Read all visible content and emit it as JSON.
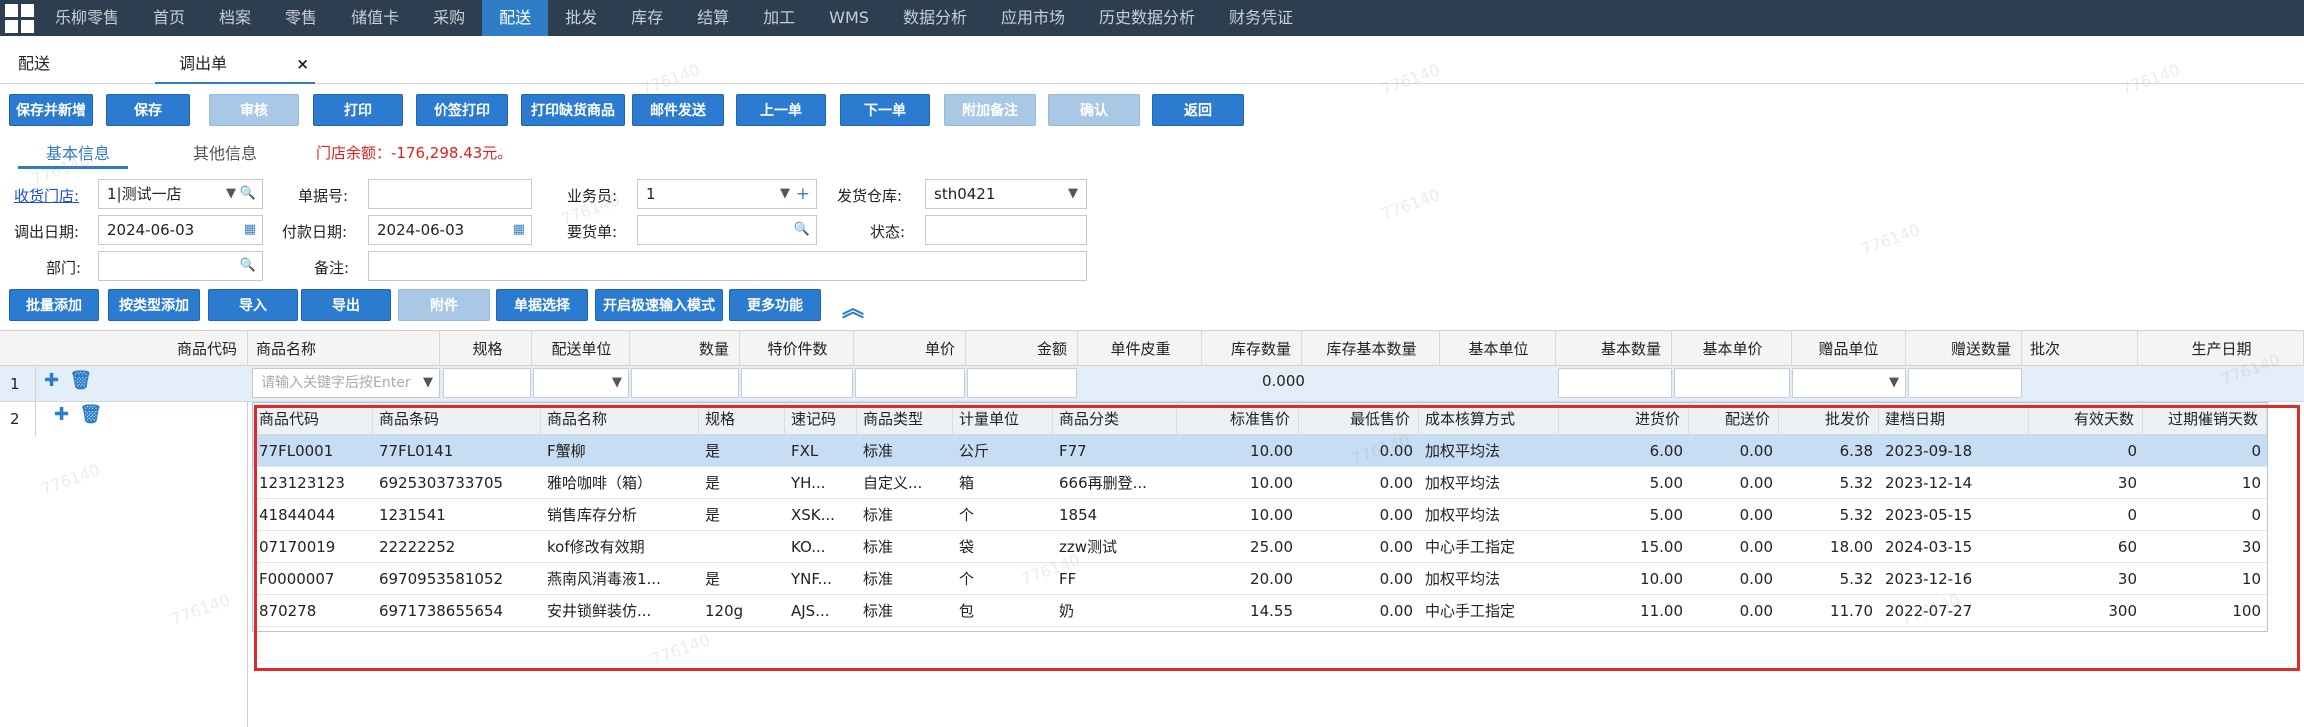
{
  "nav": {
    "items": [
      "乐柳零售",
      "首页",
      "档案",
      "零售",
      "储值卡",
      "采购",
      "配送",
      "批发",
      "库存",
      "结算",
      "加工",
      "WMS",
      "数据分析",
      "应用市场",
      "历史数据分析",
      "财务凭证"
    ],
    "active": "配送"
  },
  "tabs": {
    "t1": "配送",
    "t2": "调出单",
    "close": "×"
  },
  "toolbar": {
    "save_new": "保存并新增",
    "save": "保存",
    "audit": "审核",
    "print": "打印",
    "price_print": "价签打印",
    "print_missing": "打印缺货商品",
    "mail": "邮件发送",
    "prev": "上一单",
    "next": "下一单",
    "add_note": "附加备注",
    "confirm": "确认",
    "back": "返回"
  },
  "subtabs": {
    "basic": "基本信息",
    "other": "其他信息",
    "balance": "门店余额：-176,298.43元。"
  },
  "form": {
    "store_label": "收货门店:",
    "store_value": "1|测试一店",
    "docno_label": "单据号:",
    "docno_value": "",
    "staff_label": "业务员:",
    "staff_value": "1",
    "warehouse_label": "发货仓库:",
    "warehouse_value": "sth0421",
    "date_label": "调出日期:",
    "date_value": "2024-06-03",
    "paydate_label": "付款日期:",
    "paydate_value": "2024-06-03",
    "request_label": "要货单:",
    "request_value": "",
    "status_label": "状态:",
    "status_value": "",
    "dept_label": "部门:",
    "dept_value": "",
    "remark_label": "备注:",
    "remark_value": ""
  },
  "toolbar2": {
    "batch_add": "批量添加",
    "type_add": "按类型添加",
    "import": "导入",
    "export": "导出",
    "attach": "附件",
    "doc_select": "单据选择",
    "fast_mode": "开启极速输入模式",
    "more": "更多功能"
  },
  "grid": {
    "headers": [
      "商品代码",
      "商品名称",
      "规格",
      "配送单位",
      "数量",
      "特价件数",
      "单价",
      "金额",
      "单件皮重",
      "库存数量",
      "库存基本数量",
      "基本单位",
      "基本数量",
      "基本单价",
      "赠品单位",
      "赠送数量",
      "批次",
      "生产日期"
    ],
    "row1_num": "1",
    "row2_num": "2",
    "search_placeholder": "请输入关键字后按Enter",
    "amount_total": "0.000"
  },
  "dropdown": {
    "headers": [
      "商品代码",
      "商品条码",
      "商品名称",
      "规格",
      "速记码",
      "商品类型",
      "计量单位",
      "商品分类",
      "标准售价",
      "最低售价",
      "成本核算方式",
      "进货价",
      "配送价",
      "批发价",
      "建档日期",
      "有效天数",
      "过期催销天数"
    ],
    "rows": [
      [
        "77FL0001",
        "77FL0141",
        "F蟹柳",
        "是",
        "FXL",
        "标准",
        "公斤",
        "F77",
        "10.00",
        "0.00",
        "加权平均法",
        "6.00",
        "0.00",
        "6.38",
        "2023-09-18",
        "0",
        "0"
      ],
      [
        "123123123",
        "6925303733705",
        "雅哈咖啡（箱）",
        "是",
        "YH...",
        "自定义...",
        "箱",
        "666再删登...",
        "10.00",
        "0.00",
        "加权平均法",
        "5.00",
        "0.00",
        "5.32",
        "2023-12-14",
        "30",
        "10"
      ],
      [
        "41844044",
        "1231541",
        "销售库存分析",
        "是",
        "XSK...",
        "标准",
        "个",
        "1854",
        "10.00",
        "0.00",
        "加权平均法",
        "5.00",
        "0.00",
        "5.32",
        "2023-05-15",
        "0",
        "0"
      ],
      [
        "07170019",
        "22222252",
        "kof修改有效期",
        "",
        "KO...",
        "标准",
        "袋",
        "zzw测试",
        "25.00",
        "0.00",
        "中心手工指定",
        "15.00",
        "0.00",
        "18.00",
        "2024-03-15",
        "60",
        "30"
      ],
      [
        "F0000007",
        "6970953581052",
        "燕南风消毒液1...",
        "是",
        "YNF...",
        "标准",
        "个",
        "FF",
        "20.00",
        "0.00",
        "加权平均法",
        "10.00",
        "0.00",
        "5.32",
        "2023-12-16",
        "30",
        "10"
      ],
      [
        "870278",
        "6971738655654",
        "安井锁鲜装仿...",
        "120g",
        "AJS...",
        "标准",
        "包",
        "奶",
        "14.55",
        "0.00",
        "中心手工指定",
        "11.00",
        "0.00",
        "11.70",
        "2022-07-27",
        "300",
        "100"
      ]
    ]
  },
  "watermark": "776140"
}
